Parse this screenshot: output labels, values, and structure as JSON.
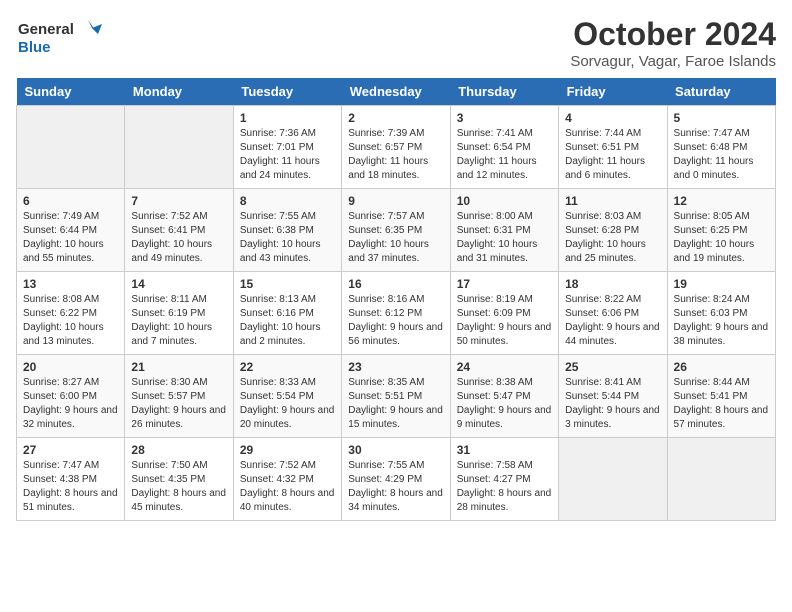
{
  "logo": {
    "general": "General",
    "blue": "Blue"
  },
  "title": "October 2024",
  "location": "Sorvagur, Vagar, Faroe Islands",
  "days_of_week": [
    "Sunday",
    "Monday",
    "Tuesday",
    "Wednesday",
    "Thursday",
    "Friday",
    "Saturday"
  ],
  "weeks": [
    [
      {
        "day": "",
        "sunrise": "",
        "sunset": "",
        "daylight": ""
      },
      {
        "day": "",
        "sunrise": "",
        "sunset": "",
        "daylight": ""
      },
      {
        "day": "1",
        "sunrise": "Sunrise: 7:36 AM",
        "sunset": "Sunset: 7:01 PM",
        "daylight": "Daylight: 11 hours and 24 minutes."
      },
      {
        "day": "2",
        "sunrise": "Sunrise: 7:39 AM",
        "sunset": "Sunset: 6:57 PM",
        "daylight": "Daylight: 11 hours and 18 minutes."
      },
      {
        "day": "3",
        "sunrise": "Sunrise: 7:41 AM",
        "sunset": "Sunset: 6:54 PM",
        "daylight": "Daylight: 11 hours and 12 minutes."
      },
      {
        "day": "4",
        "sunrise": "Sunrise: 7:44 AM",
        "sunset": "Sunset: 6:51 PM",
        "daylight": "Daylight: 11 hours and 6 minutes."
      },
      {
        "day": "5",
        "sunrise": "Sunrise: 7:47 AM",
        "sunset": "Sunset: 6:48 PM",
        "daylight": "Daylight: 11 hours and 0 minutes."
      }
    ],
    [
      {
        "day": "6",
        "sunrise": "Sunrise: 7:49 AM",
        "sunset": "Sunset: 6:44 PM",
        "daylight": "Daylight: 10 hours and 55 minutes."
      },
      {
        "day": "7",
        "sunrise": "Sunrise: 7:52 AM",
        "sunset": "Sunset: 6:41 PM",
        "daylight": "Daylight: 10 hours and 49 minutes."
      },
      {
        "day": "8",
        "sunrise": "Sunrise: 7:55 AM",
        "sunset": "Sunset: 6:38 PM",
        "daylight": "Daylight: 10 hours and 43 minutes."
      },
      {
        "day": "9",
        "sunrise": "Sunrise: 7:57 AM",
        "sunset": "Sunset: 6:35 PM",
        "daylight": "Daylight: 10 hours and 37 minutes."
      },
      {
        "day": "10",
        "sunrise": "Sunrise: 8:00 AM",
        "sunset": "Sunset: 6:31 PM",
        "daylight": "Daylight: 10 hours and 31 minutes."
      },
      {
        "day": "11",
        "sunrise": "Sunrise: 8:03 AM",
        "sunset": "Sunset: 6:28 PM",
        "daylight": "Daylight: 10 hours and 25 minutes."
      },
      {
        "day": "12",
        "sunrise": "Sunrise: 8:05 AM",
        "sunset": "Sunset: 6:25 PM",
        "daylight": "Daylight: 10 hours and 19 minutes."
      }
    ],
    [
      {
        "day": "13",
        "sunrise": "Sunrise: 8:08 AM",
        "sunset": "Sunset: 6:22 PM",
        "daylight": "Daylight: 10 hours and 13 minutes."
      },
      {
        "day": "14",
        "sunrise": "Sunrise: 8:11 AM",
        "sunset": "Sunset: 6:19 PM",
        "daylight": "Daylight: 10 hours and 7 minutes."
      },
      {
        "day": "15",
        "sunrise": "Sunrise: 8:13 AM",
        "sunset": "Sunset: 6:16 PM",
        "daylight": "Daylight: 10 hours and 2 minutes."
      },
      {
        "day": "16",
        "sunrise": "Sunrise: 8:16 AM",
        "sunset": "Sunset: 6:12 PM",
        "daylight": "Daylight: 9 hours and 56 minutes."
      },
      {
        "day": "17",
        "sunrise": "Sunrise: 8:19 AM",
        "sunset": "Sunset: 6:09 PM",
        "daylight": "Daylight: 9 hours and 50 minutes."
      },
      {
        "day": "18",
        "sunrise": "Sunrise: 8:22 AM",
        "sunset": "Sunset: 6:06 PM",
        "daylight": "Daylight: 9 hours and 44 minutes."
      },
      {
        "day": "19",
        "sunrise": "Sunrise: 8:24 AM",
        "sunset": "Sunset: 6:03 PM",
        "daylight": "Daylight: 9 hours and 38 minutes."
      }
    ],
    [
      {
        "day": "20",
        "sunrise": "Sunrise: 8:27 AM",
        "sunset": "Sunset: 6:00 PM",
        "daylight": "Daylight: 9 hours and 32 minutes."
      },
      {
        "day": "21",
        "sunrise": "Sunrise: 8:30 AM",
        "sunset": "Sunset: 5:57 PM",
        "daylight": "Daylight: 9 hours and 26 minutes."
      },
      {
        "day": "22",
        "sunrise": "Sunrise: 8:33 AM",
        "sunset": "Sunset: 5:54 PM",
        "daylight": "Daylight: 9 hours and 20 minutes."
      },
      {
        "day": "23",
        "sunrise": "Sunrise: 8:35 AM",
        "sunset": "Sunset: 5:51 PM",
        "daylight": "Daylight: 9 hours and 15 minutes."
      },
      {
        "day": "24",
        "sunrise": "Sunrise: 8:38 AM",
        "sunset": "Sunset: 5:47 PM",
        "daylight": "Daylight: 9 hours and 9 minutes."
      },
      {
        "day": "25",
        "sunrise": "Sunrise: 8:41 AM",
        "sunset": "Sunset: 5:44 PM",
        "daylight": "Daylight: 9 hours and 3 minutes."
      },
      {
        "day": "26",
        "sunrise": "Sunrise: 8:44 AM",
        "sunset": "Sunset: 5:41 PM",
        "daylight": "Daylight: 8 hours and 57 minutes."
      }
    ],
    [
      {
        "day": "27",
        "sunrise": "Sunrise: 7:47 AM",
        "sunset": "Sunset: 4:38 PM",
        "daylight": "Daylight: 8 hours and 51 minutes."
      },
      {
        "day": "28",
        "sunrise": "Sunrise: 7:50 AM",
        "sunset": "Sunset: 4:35 PM",
        "daylight": "Daylight: 8 hours and 45 minutes."
      },
      {
        "day": "29",
        "sunrise": "Sunrise: 7:52 AM",
        "sunset": "Sunset: 4:32 PM",
        "daylight": "Daylight: 8 hours and 40 minutes."
      },
      {
        "day": "30",
        "sunrise": "Sunrise: 7:55 AM",
        "sunset": "Sunset: 4:29 PM",
        "daylight": "Daylight: 8 hours and 34 minutes."
      },
      {
        "day": "31",
        "sunrise": "Sunrise: 7:58 AM",
        "sunset": "Sunset: 4:27 PM",
        "daylight": "Daylight: 8 hours and 28 minutes."
      },
      {
        "day": "",
        "sunrise": "",
        "sunset": "",
        "daylight": ""
      },
      {
        "day": "",
        "sunrise": "",
        "sunset": "",
        "daylight": ""
      }
    ]
  ]
}
